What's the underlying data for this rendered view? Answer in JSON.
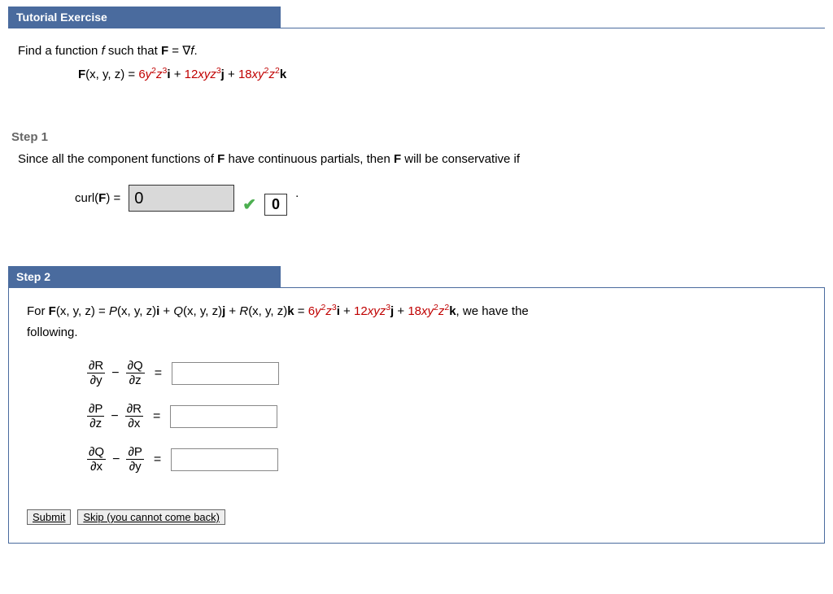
{
  "header": {
    "title": "Tutorial Exercise"
  },
  "intro": {
    "line1_pre": "Find a function ",
    "line1_var": "f",
    "line1_mid": " such that ",
    "line1_F": "F",
    "line1_eq": " = ∇",
    "line1_f2": "f",
    "line1_end": ".",
    "eq_lhs": "F",
    "eq_args": "(x, y, z) = ",
    "t1a": "6",
    "t1b": "y",
    "t1c": "z",
    "t1v": "i",
    "plus1": " + ",
    "t2a": "12",
    "t2b": "xyz",
    "t2v": "j",
    "plus2": " + ",
    "t3a": "18",
    "t3b": "xy",
    "t3c": "z",
    "t3v": "k"
  },
  "step1": {
    "label": "Step 1",
    "text_a": "Since all the component functions of ",
    "text_F": "F",
    "text_b": " have continuous partials, then ",
    "text_F2": "F",
    "text_c": " will be conservative if",
    "curl_lhs": "curl(",
    "curl_F": "F",
    "curl_rhs": ") = ",
    "answer": "0",
    "hint": "0"
  },
  "step2": {
    "label": "Step 2",
    "pre": "For  ",
    "F": "F",
    "args": "(x, y, z) = ",
    "P": "P",
    "Pargs": "(x, y, z)",
    "i": "i",
    "plusA": " + ",
    "Q": "Q",
    "Qargs": "(x, y, z)",
    "j": "j",
    "plusB": " + ",
    "R": "R",
    "Rargs": "(x, y, z)",
    "k": "k",
    "eq": " = ",
    "t1a": "6",
    "t1b": "y",
    "t1c": "z",
    "t1v": "i",
    "plus1": " + ",
    "t2a": "12",
    "t2b": "xyz",
    "t2v": "j",
    "plus2": " + ",
    "t3a": "18",
    "t3b": "xy",
    "t3c": "z",
    "t3v": "k",
    "tail": ",  we have the",
    "following": "following.",
    "rows": [
      {
        "n1": "∂R",
        "d1": "∂y",
        "n2": "∂Q",
        "d2": "∂z"
      },
      {
        "n1": "∂P",
        "d1": "∂z",
        "n2": "∂R",
        "d2": "∂x"
      },
      {
        "n1": "∂Q",
        "d1": "∂x",
        "n2": "∂P",
        "d2": "∂y"
      }
    ],
    "minus": "−",
    "equals": "="
  },
  "buttons": {
    "submit": "Submit",
    "skip": "Skip (you cannot come back)"
  }
}
